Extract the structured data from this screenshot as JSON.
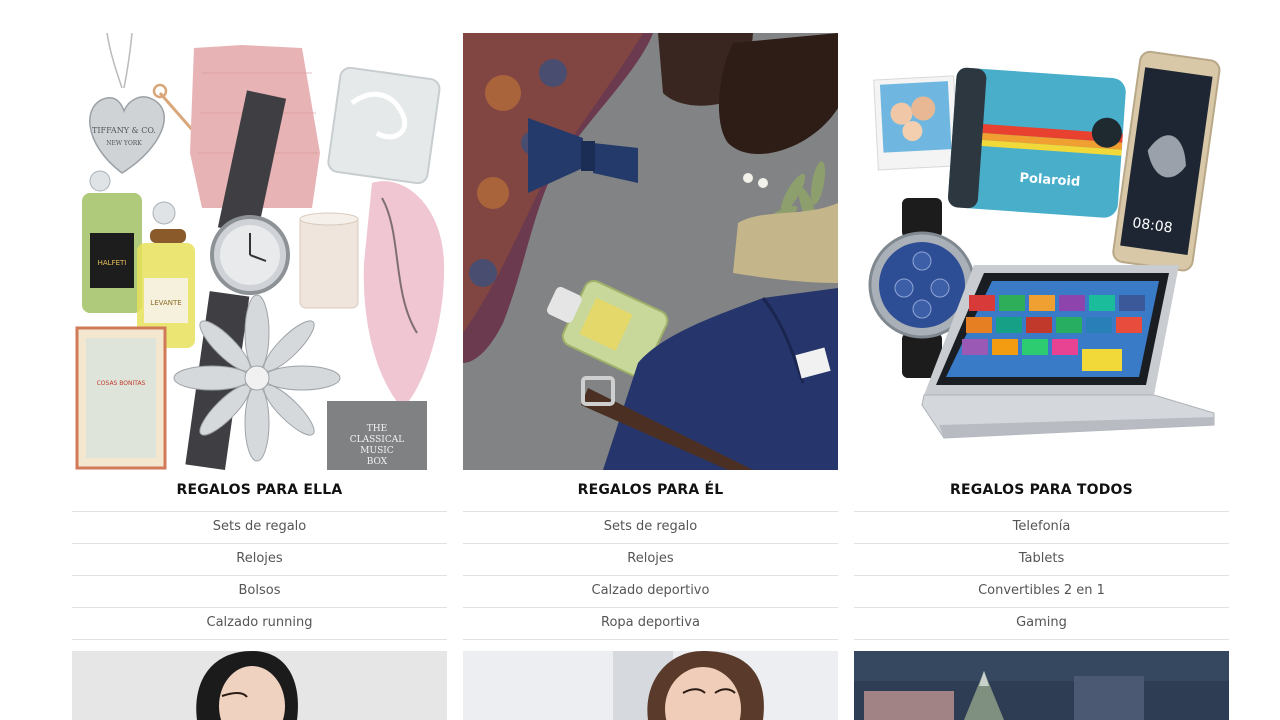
{
  "categories": [
    {
      "title": "REGALOS PARA ELLA",
      "links": [
        "Sets de regalo",
        "Relojes",
        "Bolsos",
        "Calzado running"
      ],
      "image_text": {
        "tag": "TIFFANY & CO.",
        "tag_sub": "NEW YORK",
        "book_lines": [
          "THE",
          "CLASSICAL",
          "MUSIC",
          "BOX"
        ],
        "coloring_book": "COSAS BONITAS",
        "perfume1": "HALFETI",
        "perfume2": "LEVANTE"
      }
    },
    {
      "title": "REGALOS PARA ÉL",
      "links": [
        "Sets de regalo",
        "Relojes",
        "Calzado deportivo",
        "Ropa deportiva"
      ]
    },
    {
      "title": "REGALOS PARA TODOS",
      "links": [
        "Telefonía",
        "Tablets",
        "Convertibles 2 en 1",
        "Gaming"
      ],
      "image_text": {
        "camera_brand": "Polaroid",
        "phone_time": "08:08"
      }
    }
  ],
  "colors": {
    "divider": "#e2e2e2",
    "title_text": "#111111",
    "link_text": "#555555"
  }
}
